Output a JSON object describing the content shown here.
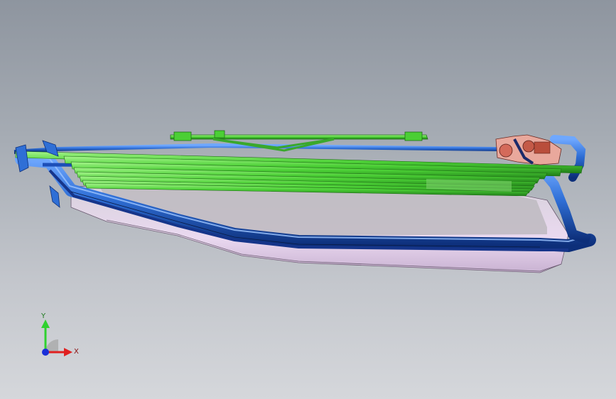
{
  "viewport": {
    "name": "graphics-area",
    "colors": {
      "bg_top": "#8e959f",
      "bg_bottom": "#d5d7db",
      "tube_blue": "#2f6fd6",
      "tube_dark": "#0d2f7a",
      "rail_green": "#52d43b",
      "panel_pink": "#e8d6ee",
      "panel_grey": "#c9c5cd",
      "mechanism_red": "#d46a5a"
    }
  },
  "model": {
    "parts": [
      "outer-tube-frame",
      "green-slat-bundle",
      "pink-underside-panel",
      "top-guide-rail",
      "drive-mechanism"
    ]
  },
  "triad": {
    "y_label": "Y",
    "x_label": "X",
    "y_color": "#2fd12f",
    "x_color": "#e02020",
    "z_color": "#1a2fd8"
  }
}
